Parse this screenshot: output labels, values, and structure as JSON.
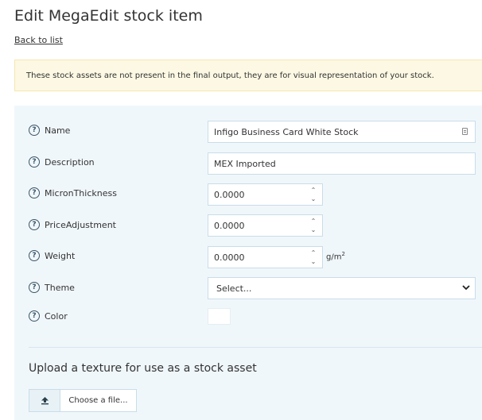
{
  "page": {
    "title": "Edit MegaEdit stock item",
    "back_link": "Back to list"
  },
  "notice": {
    "text": "These stock assets are not present in the final output, they are for visual representation of your stock."
  },
  "form": {
    "help_glyph": "?",
    "fields": {
      "name": {
        "label": "Name",
        "value": "Infigo Business Card White Stock"
      },
      "description": {
        "label": "Description",
        "value": "MEX Imported"
      },
      "micron_thickness": {
        "label": "MicronThickness",
        "value": "0.0000"
      },
      "price_adjustment": {
        "label": "PriceAdjustment",
        "value": "0.0000"
      },
      "weight": {
        "label": "Weight",
        "value": "0.0000",
        "unit": "g/m",
        "unit_exp": "2"
      },
      "theme": {
        "label": "Theme",
        "value": "Select..."
      },
      "color": {
        "label": "Color",
        "value": "#ffffff"
      }
    },
    "stepper": {
      "up": "⌃",
      "down": "⌄"
    }
  },
  "upload": {
    "title": "Upload a texture for use as a stock asset",
    "button_label": "Choose a file..."
  },
  "colors": {
    "panel_bg": "#f0f7fb",
    "notice_bg": "#fcf8e3",
    "field_border": "#c9dde8",
    "icon_color": "#3a5566"
  },
  "icons": {
    "help": "question-circle-icon",
    "keyboard": "input-keyboard-icon",
    "chevron": "chevron-down-icon",
    "upload": "upload-arrow-icon"
  }
}
